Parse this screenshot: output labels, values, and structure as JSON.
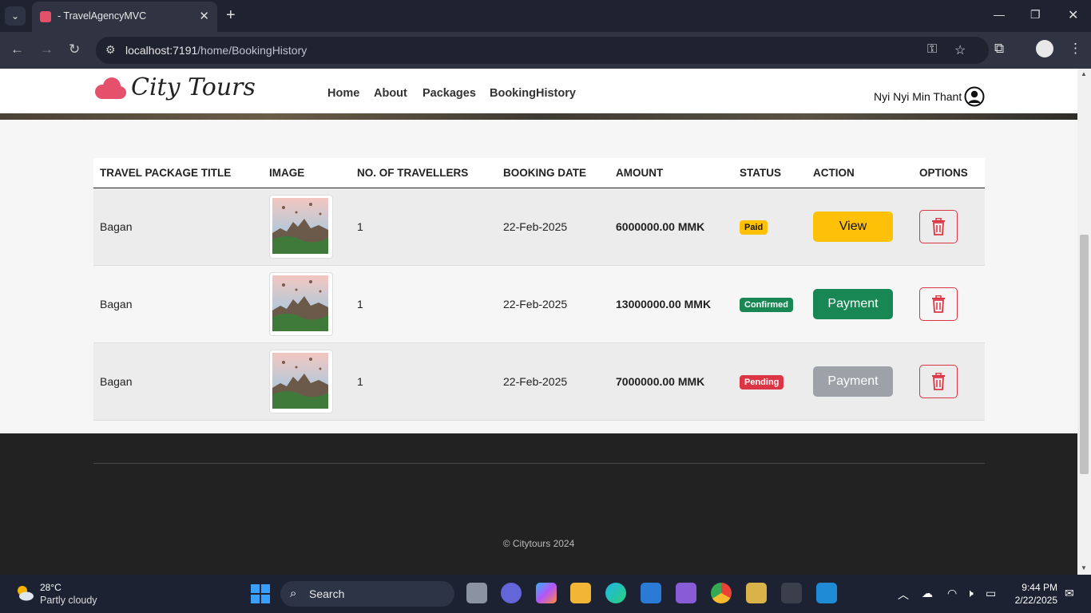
{
  "browser": {
    "tab_title": "- TravelAgencyMVC",
    "url_host": "localhost:7191",
    "url_path": "/home/BookingHistory"
  },
  "site": {
    "logo_text": "City Tours",
    "nav": [
      "Home",
      "About",
      "Packages",
      "BookingHistory"
    ],
    "user_name": "Nyi Nyi Min Thant"
  },
  "table": {
    "headers": [
      "TRAVEL PACKAGE TITLE",
      "IMAGE",
      "NO. OF TRAVELLERS",
      "BOOKING DATE",
      "AMOUNT",
      "STATUS",
      "ACTION",
      "OPTIONS"
    ],
    "rows": [
      {
        "title": "Bagan",
        "travellers": "1",
        "date": "22-Feb-2025",
        "amount": "6000000.00 MMK",
        "status": "Paid",
        "status_color": "#ffc107",
        "action": "View",
        "action_color": "#ffc107"
      },
      {
        "title": "Bagan",
        "travellers": "1",
        "date": "22-Feb-2025",
        "amount": "13000000.00 MMK",
        "status": "Confirmed",
        "status_color": "#198754",
        "action": "Payment",
        "action_color": "#198754"
      },
      {
        "title": "Bagan",
        "travellers": "1",
        "date": "22-Feb-2025",
        "amount": "7000000.00 MMK",
        "status": "Pending",
        "status_color": "#dc3545",
        "action": "Payment",
        "action_color": "#9da2a8"
      }
    ]
  },
  "footer": {
    "copyright": "© Citytours 2024"
  },
  "taskbar": {
    "temperature": "28°C",
    "weather": "Partly cloudy",
    "search": "Search",
    "time": "9:44 PM",
    "date": "2/22/2025"
  }
}
